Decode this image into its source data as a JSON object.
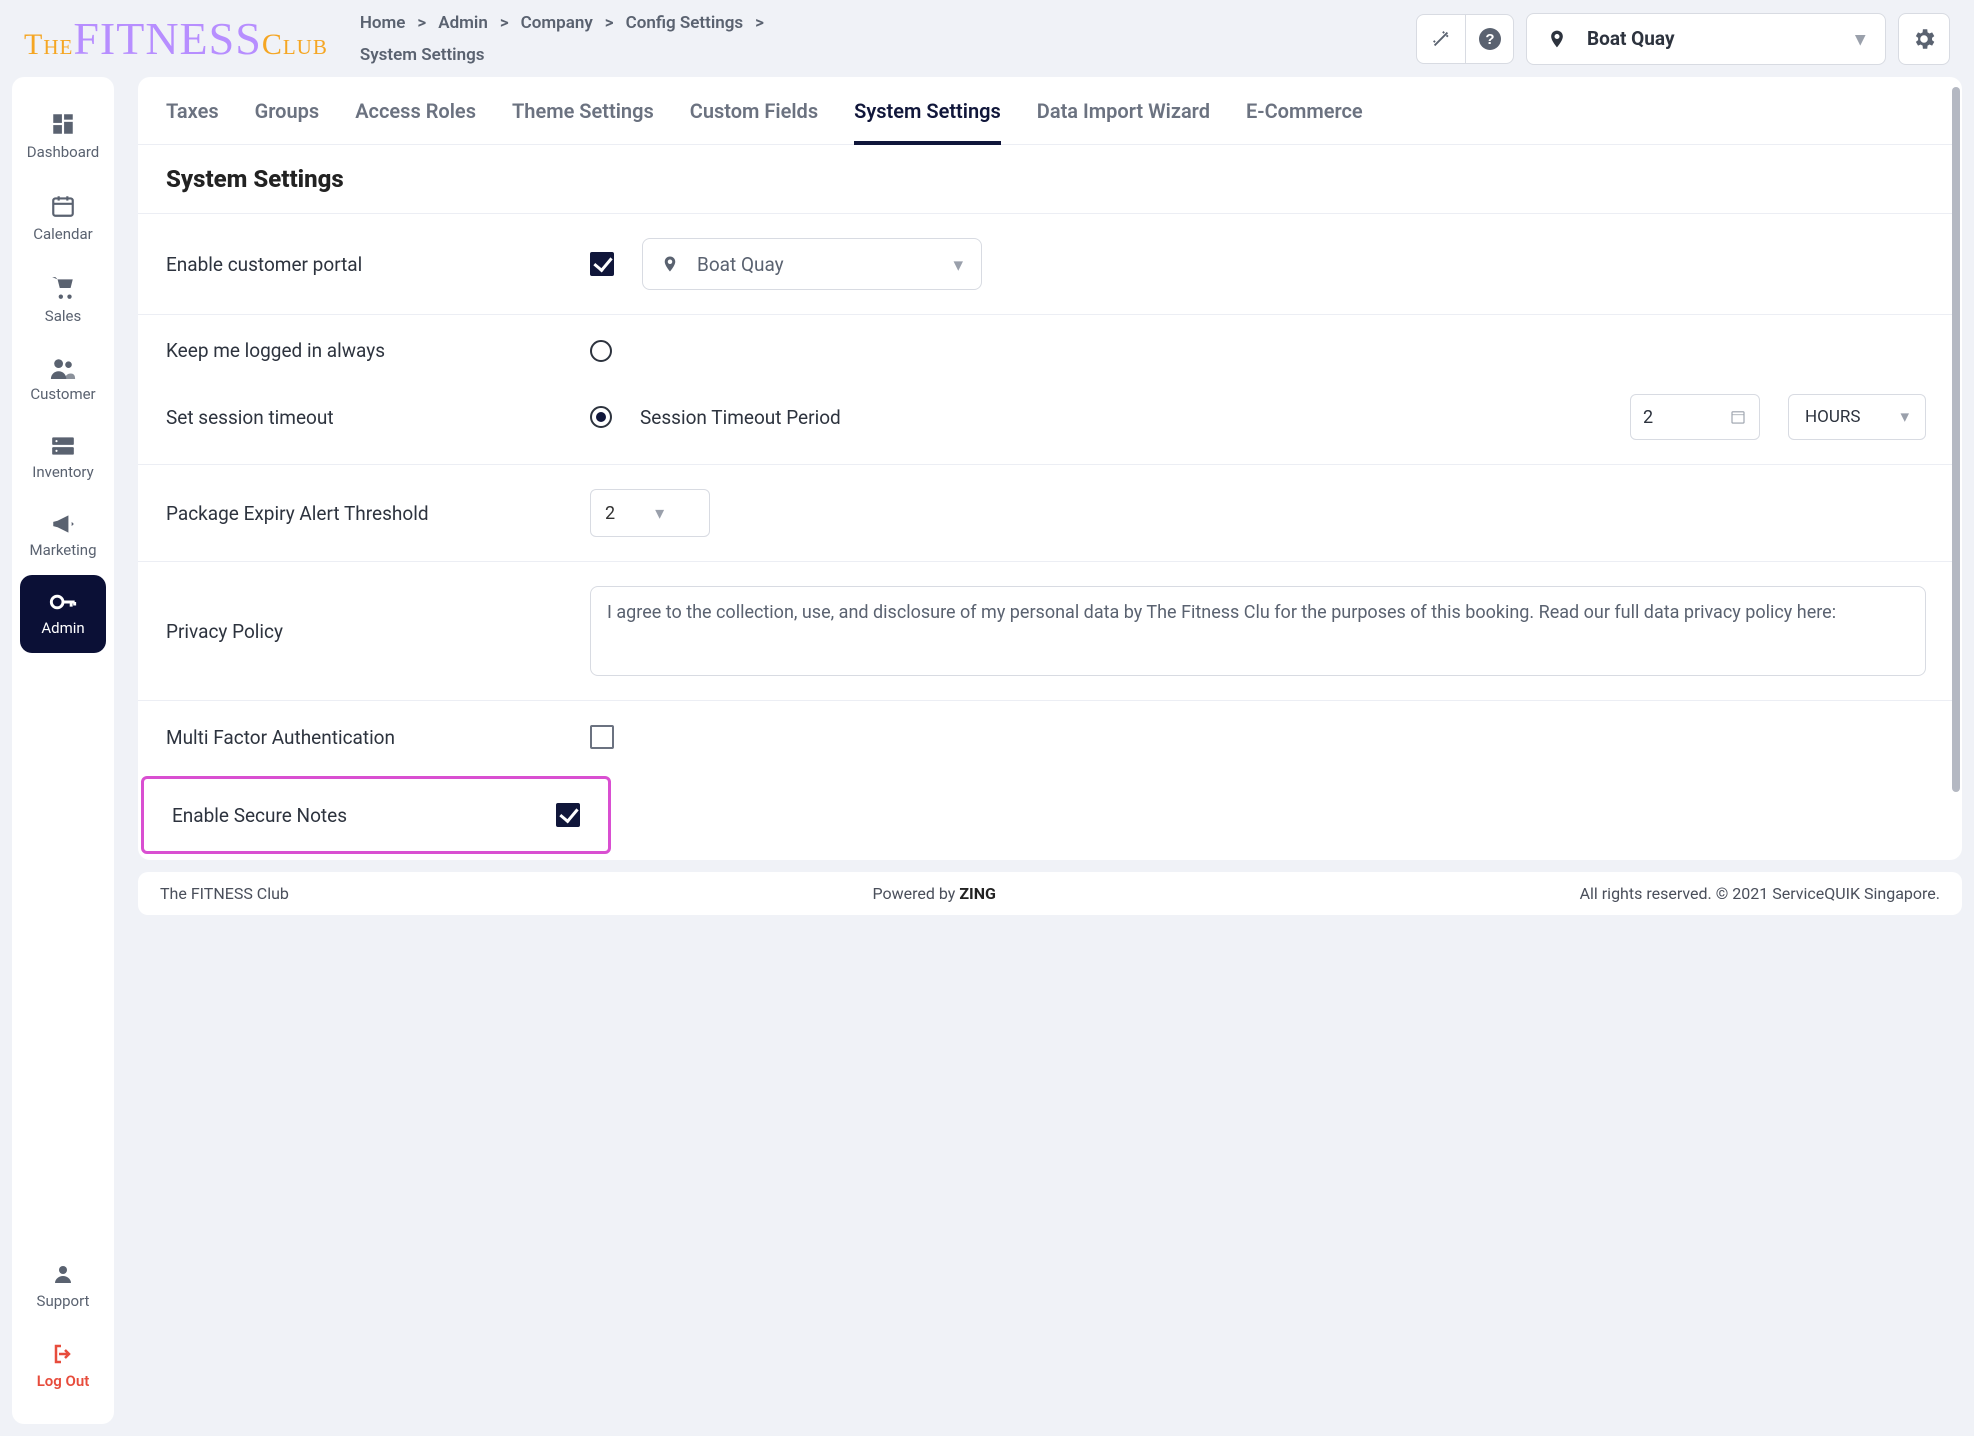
{
  "logo": {
    "the": "The",
    "fitness": "FITNESS",
    "club": "Club"
  },
  "breadcrumbs": [
    "Home",
    "Admin",
    "Company",
    "Config Settings",
    "System Settings"
  ],
  "header_location": "Boat Quay",
  "sidebar": {
    "items": [
      {
        "label": "Dashboard"
      },
      {
        "label": "Calendar"
      },
      {
        "label": "Sales"
      },
      {
        "label": "Customer"
      },
      {
        "label": "Inventory"
      },
      {
        "label": "Marketing"
      },
      {
        "label": "Admin",
        "active": true
      }
    ],
    "support": "Support",
    "logout": "Log Out"
  },
  "tabs": [
    "Taxes",
    "Groups",
    "Access Roles",
    "Theme Settings",
    "Custom Fields",
    "System Settings",
    "Data Import Wizard",
    "E-Commerce"
  ],
  "active_tab": "System Settings",
  "page_title": "System Settings",
  "settings": {
    "enable_customer_portal": {
      "label": "Enable customer portal",
      "checked": true,
      "location": "Boat Quay"
    },
    "keep_logged_in": {
      "label": "Keep me logged in always",
      "selected": false
    },
    "session_timeout": {
      "label": "Set session timeout",
      "selected": true,
      "period_label": "Session Timeout Period",
      "value": "2",
      "unit": "HOURS"
    },
    "package_expiry": {
      "label": "Package Expiry Alert Threshold",
      "value": "2"
    },
    "privacy_policy": {
      "label": "Privacy Policy",
      "text": "I agree to the collection, use, and disclosure of my personal data by The Fitness Clu for the purposes of this booking. Read our full data privacy policy here:"
    },
    "mfa": {
      "label": "Multi Factor Authentication",
      "checked": false
    },
    "secure_notes": {
      "label": "Enable Secure Notes",
      "checked": true
    }
  },
  "footer": {
    "left": "The FITNESS Club",
    "powered_prefix": "Powered by ",
    "powered_brand": "ZING",
    "right": "All rights reserved. © 2021 ServiceQUIK Singapore."
  }
}
